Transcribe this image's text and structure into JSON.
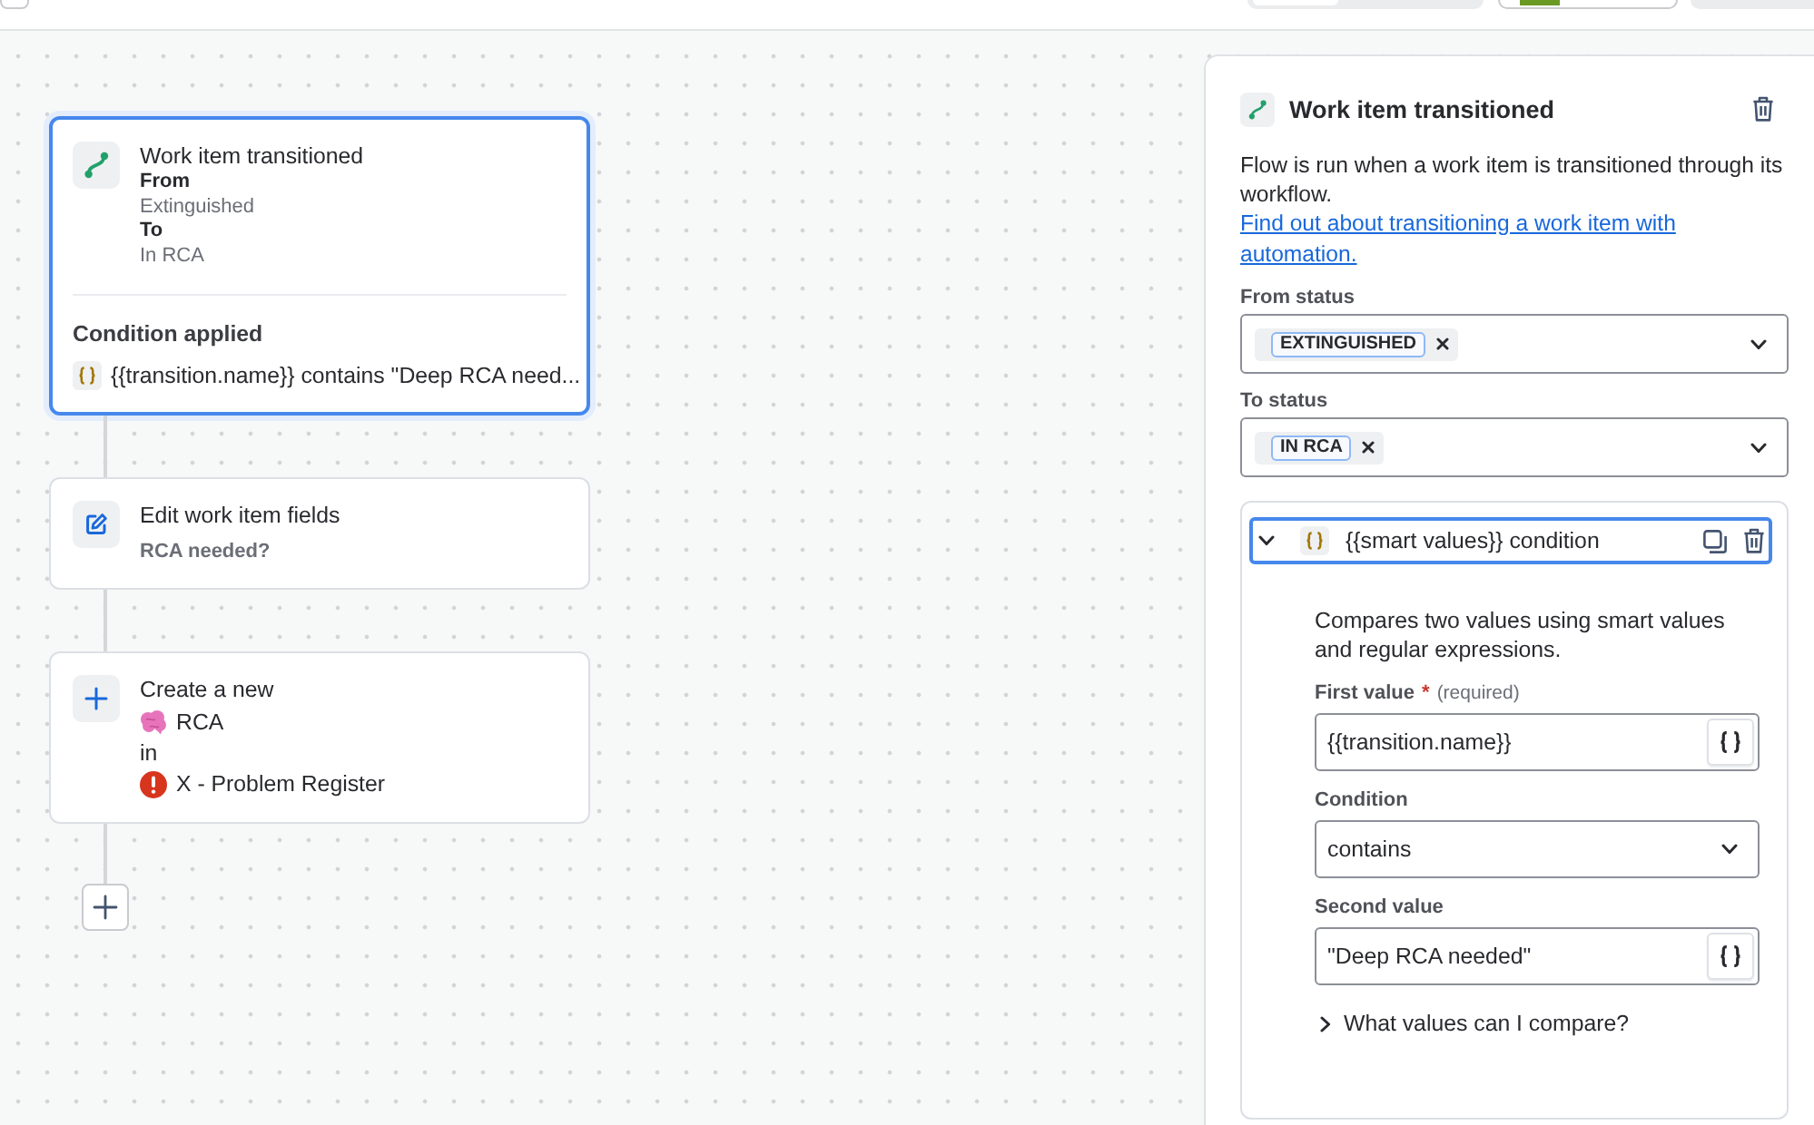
{
  "canvas": {
    "trigger": {
      "title": "Work item transitioned",
      "selected": true,
      "from_label": "From",
      "from_value": "Extinguished",
      "to_label": "To",
      "to_value": "In RCA",
      "condition_heading": "Condition applied",
      "condition_summary": "{{transition.name}} contains \"Deep RCA need..."
    },
    "steps": [
      {
        "kind": "edit",
        "selected": false,
        "title": "Edit work item fields",
        "detail": "RCA needed?"
      },
      {
        "kind": "create",
        "selected": false,
        "title": "Create a new",
        "work_type": "RCA",
        "in_label": "in",
        "project": "X - Problem Register"
      }
    ]
  },
  "panel": {
    "title": "Work item transitioned",
    "description": "Flow is run when a work item is transitioned through its workflow.",
    "link": "Find out about transitioning a work item with automation.",
    "status_fields": [
      {
        "label": "From status",
        "chips": [
          "EXTINGUISHED"
        ]
      },
      {
        "label": "To status",
        "chips": [
          "IN RCA"
        ]
      }
    ],
    "condition": {
      "title": "{{smart values}} condition",
      "selected": true,
      "expanded": true,
      "description": "Compares two values using smart values and regular expressions.",
      "fields": [
        {
          "kind": "text",
          "label": "First value",
          "required_mark": "*",
          "required_note": "(required)",
          "value": "{{transition.name}}"
        },
        {
          "kind": "select",
          "label": "Condition",
          "value": "contains"
        },
        {
          "kind": "text",
          "label": "Second value",
          "value": "\"Deep RCA needed\""
        }
      ],
      "help": {
        "label": "What values can I compare?",
        "expanded": false
      }
    }
  }
}
